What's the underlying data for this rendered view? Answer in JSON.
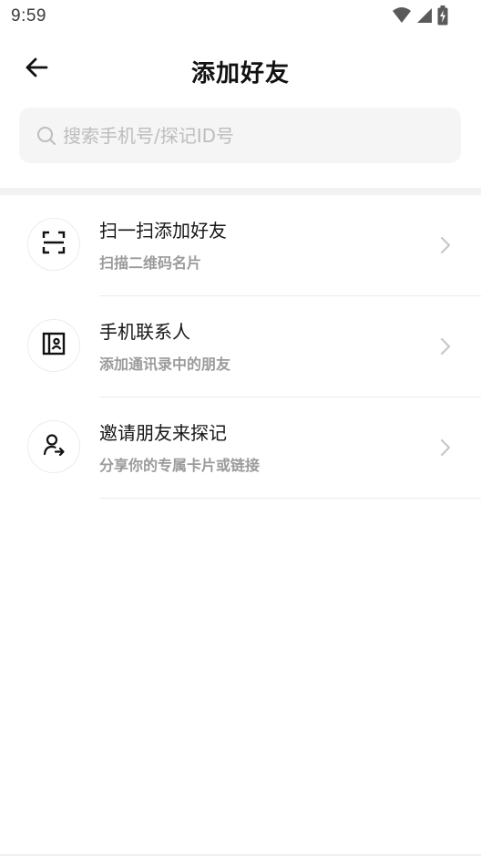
{
  "status_bar": {
    "time": "9:59",
    "icons": [
      "wifi-icon",
      "signal-icon",
      "battery-charging-icon"
    ]
  },
  "header": {
    "title": "添加好友",
    "back_icon": "arrow-left-icon"
  },
  "search": {
    "placeholder": "搜索手机号/探记ID号",
    "value": "",
    "icon": "search-icon"
  },
  "menu": {
    "items": [
      {
        "icon": "scan-icon",
        "title": "扫一扫添加好友",
        "subtitle": "扫描二维码名片"
      },
      {
        "icon": "contacts-book-icon",
        "title": "手机联系人",
        "subtitle": "添加通讯录中的朋友"
      },
      {
        "icon": "share-user-icon",
        "title": "邀请朋友来探记",
        "subtitle": "分享你的专属卡片或链接"
      }
    ]
  },
  "colors": {
    "title": "#111111",
    "subtitle": "#9b9b9b",
    "placeholder": "#bdbdbd",
    "search_bg": "#f5f5f5",
    "divider": "#ebebeb",
    "chevron": "#c8c8c8"
  }
}
